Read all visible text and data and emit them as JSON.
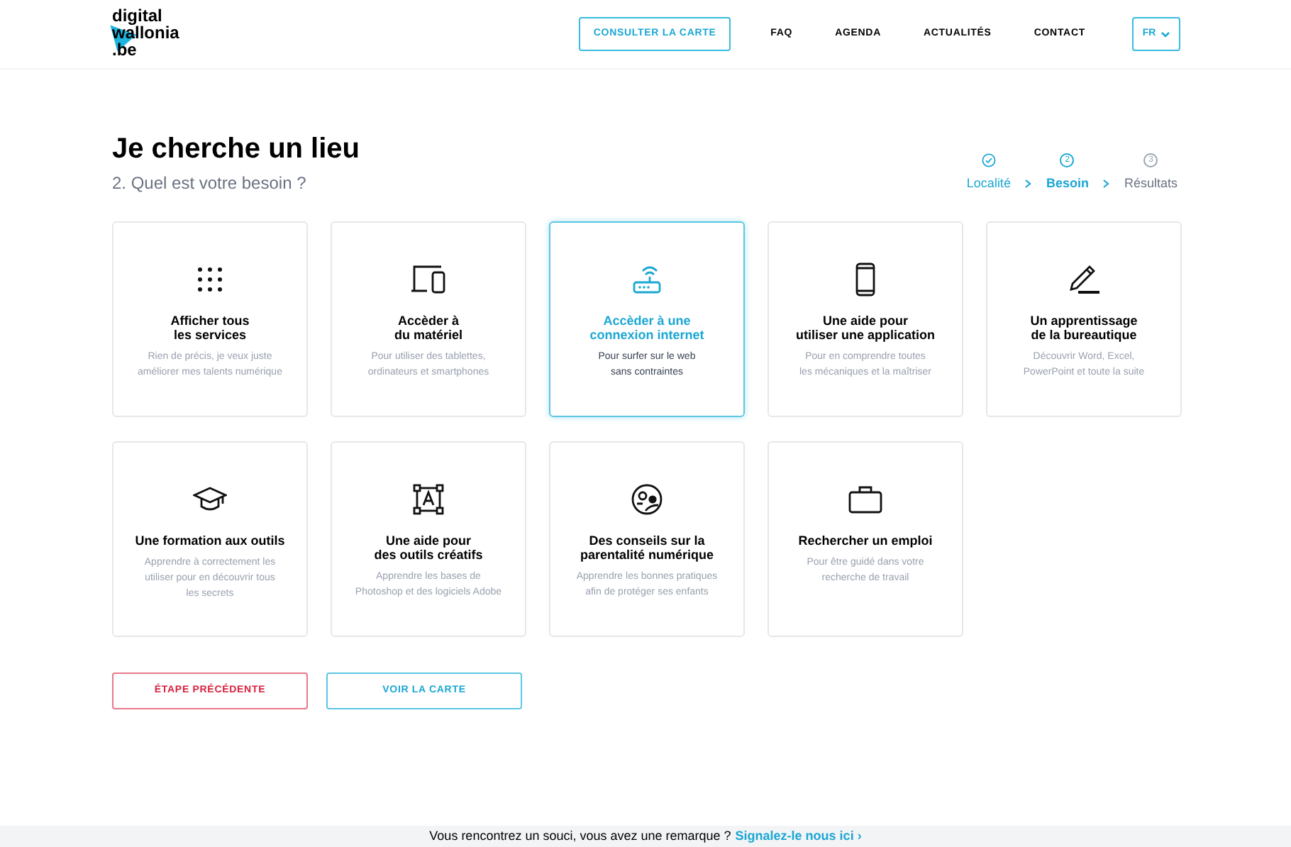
{
  "header": {
    "logo": [
      "digital",
      "wallonia",
      ".be"
    ],
    "map_button": "CONSULTER LA CARTE",
    "nav": [
      "FAQ",
      "AGENDA",
      "ACTUALITÉS",
      "CONTACT"
    ],
    "language": "FR"
  },
  "page": {
    "title": "Je cherche un lieu",
    "subtitle": "2. Quel est votre besoin ?"
  },
  "steps": [
    {
      "label": "Localité",
      "completed": true,
      "selected": false
    },
    {
      "label": "Besoin",
      "completed": false,
      "selected": true,
      "number": "2"
    },
    {
      "label": "Résultats",
      "completed": false,
      "selected": false,
      "number": "3"
    }
  ],
  "cards": [
    {
      "kind": "dots",
      "title": "Afficher tous\nles services",
      "description": "Rien de précis, je veux juste\naméliorer mes talents numérique",
      "selected": false
    },
    {
      "kind": "devices",
      "title": "Accèder à\ndu matériel",
      "description": "Pour utiliser des tablettes,\nordinateurs et smartphones",
      "selected": false
    },
    {
      "kind": "router",
      "title": "Accèder à une\nconnexion internet",
      "description": "Pour surfer sur le web\nsans contraintes",
      "selected": true
    },
    {
      "kind": "phone",
      "title": "Une aide pour\nutiliser une application",
      "description": "Pour en comprendre toutes\nles mécaniques et la maîtriser",
      "selected": false
    },
    {
      "kind": "pen",
      "title": "Un apprentissage\nde la bureautique",
      "description": "Découvrir Word, Excel,\nPowerPoint et toute la suite",
      "selected": false
    },
    {
      "kind": "cap",
      "title": "Une formation aux outils",
      "description": "Apprendre à correctement les\nutiliser pour en découvrir tous\nles secrets",
      "selected": false
    },
    {
      "kind": "text",
      "title": "Une aide pour\ndes outils créatifs",
      "description": "Apprendre les bases de\nPhotoshop et des logiciels Adobe",
      "selected": false
    },
    {
      "kind": "family",
      "title": "Des conseils sur la\nparentalité numérique",
      "description": "Apprendre les bonnes pratiques\nafin de protéger ses enfants",
      "selected": false
    },
    {
      "kind": "briefcase",
      "title": "Rechercher un emploi",
      "description": "Pour être guidé dans votre\nrecherche de travail",
      "selected": false
    }
  ],
  "actions": {
    "previous": "ÉTAPE PRÉCÉDENTE",
    "map": "VOIR LA CARTE"
  },
  "footer": {
    "text": "Vous rencontrez un souci, vous avez une remarque ?",
    "link": "Signalez-le nous ici ›"
  }
}
